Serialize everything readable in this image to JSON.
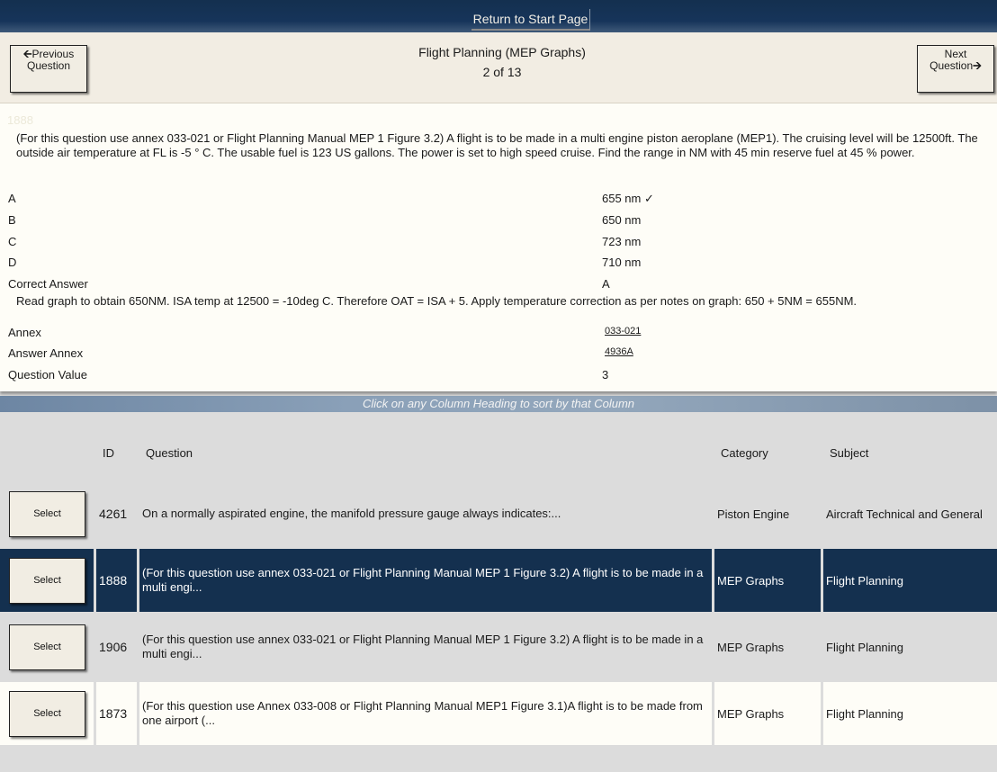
{
  "topbar": {
    "return_label": "Return to Start Page"
  },
  "header": {
    "prev_label": "Previous",
    "prev_label2": "Question",
    "next_label": "Next",
    "next_label2": "Question",
    "title": "Flight Planning (MEP Graphs)",
    "counter": "2 of 13"
  },
  "question": {
    "id": "1888",
    "text": "(For this question use annex 033-021 or Flight Planning Manual MEP 1 Figure 3.2) A flight is to be made in a multi engine piston aeroplane (MEP1). The cruising level will be 12500ft. The outside air temperature at FL is -5 ° C. The usable fuel is 123 US gallons. The power is set to high speed cruise. Find the range in NM with 45 min reserve fuel at 45 % power.",
    "options": [
      {
        "letter": "A",
        "value": "655 nm",
        "correct_mark": "✓"
      },
      {
        "letter": "B",
        "value": "650 nm",
        "correct_mark": ""
      },
      {
        "letter": "C",
        "value": "723 nm",
        "correct_mark": ""
      },
      {
        "letter": "D",
        "value": "710 nm",
        "correct_mark": ""
      }
    ],
    "correct_answer_label": "Correct Answer",
    "correct_answer": "A",
    "explanation": "Read graph to obtain 650NM. ISA temp at 12500 = -10deg C. Therefore OAT = ISA + 5. Apply temperature correction as per notes on graph: 650 + 5NM = 655NM.",
    "annex_label": "Annex",
    "annex": "033-021",
    "answer_annex_label": "Answer Annex",
    "answer_annex": "4936A",
    "value_label": "Question Value",
    "value": "3"
  },
  "table": {
    "sort_hint": "Click on any Column Heading to sort by that Column",
    "headers": {
      "id": "ID",
      "question": "Question",
      "category": "Category",
      "subject": "Subject"
    },
    "select_label": "Select",
    "rows": [
      {
        "id": "4261",
        "question": "On a normally aspirated engine, the manifold pressure gauge always indicates:...",
        "category": "Piston Engine",
        "subject": "Aircraft Technical and General"
      },
      {
        "id": "1888",
        "question": "(For this question use annex 033-021 or Flight Planning Manual MEP 1 Figure 3.2) A flight is to be made in a multi engi...",
        "category": "MEP Graphs",
        "subject": "Flight Planning"
      },
      {
        "id": "1906",
        "question": "(For this question use annex 033-021 or Flight Planning Manual MEP 1 Figure 3.2) A flight is to be made in a multi engi...",
        "category": "MEP Graphs",
        "subject": "Flight Planning"
      },
      {
        "id": "1873",
        "question": "(For this question use Annex 033-008 or Flight Planning Manual MEP1 Figure 3.1)A flight is to be made from one airport (...",
        "category": "MEP Graphs",
        "subject": "Flight Planning"
      }
    ]
  },
  "colors": {
    "navy": "#14304f",
    "cream": "#fefdf7",
    "panel": "#f2ede3",
    "grey": "#dcdcdc"
  }
}
